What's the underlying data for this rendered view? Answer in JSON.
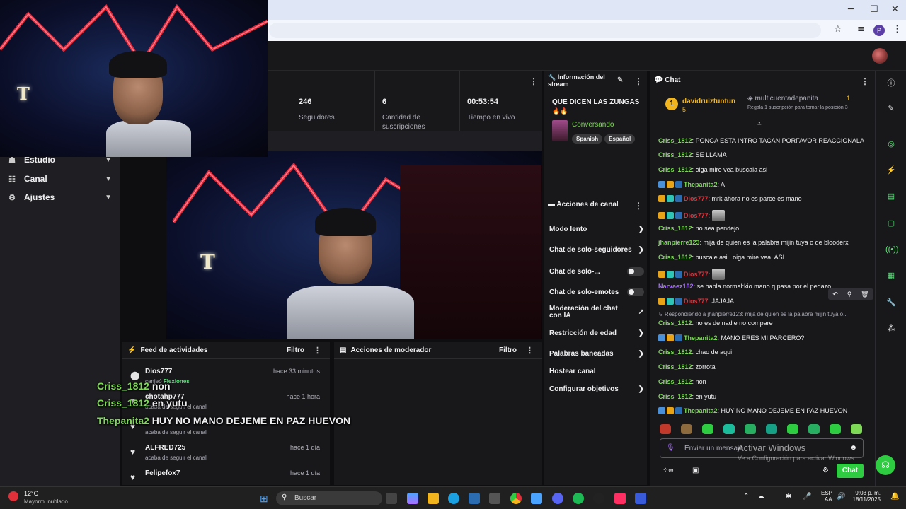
{
  "browser": {
    "minimize": "─",
    "maximize": "☐",
    "close": "✕",
    "star_icon": "star-icon",
    "profile_initial": "P"
  },
  "sidebar": {
    "items": [
      {
        "label": "Estudio",
        "icon": "☗"
      },
      {
        "label": "Canal",
        "icon": "☷"
      },
      {
        "label": "Ajustes",
        "icon": "⚙"
      }
    ]
  },
  "stats": [
    {
      "value": "246",
      "label": "Seguidores"
    },
    {
      "value": "6",
      "label": "Cantidad de suscripciones"
    },
    {
      "value": "00:53:54",
      "label": "Tiempo en vivo"
    }
  ],
  "stream_info": {
    "header": "Información del stream",
    "title": "QUE DICEN LAS ZUNGAS",
    "emoji": "🔥🔥",
    "category": "Conversando",
    "tags": [
      "Spanish",
      "Español"
    ]
  },
  "channel_actions": {
    "header": "Acciones de canal",
    "items": [
      {
        "label": "Modo lento",
        "kind": "chevron"
      },
      {
        "label": "Chat de solo-seguidores",
        "kind": "chevron"
      },
      {
        "label": "Chat de solo-...",
        "kind": "toggle"
      },
      {
        "label": "Chat de solo-emotes",
        "kind": "toggle"
      },
      {
        "label": "Moderación del chat con IA",
        "kind": "external"
      },
      {
        "label": "Restricción de edad",
        "kind": "chevron"
      },
      {
        "label": "Palabras baneadas",
        "kind": "chevron"
      },
      {
        "label": "Hostear canal",
        "kind": "none"
      },
      {
        "label": "Configurar objetivos",
        "kind": "chevron"
      }
    ]
  },
  "activity_feed": {
    "header": "Feed de actividades",
    "filter": "Filtro",
    "items": [
      {
        "name": "Dios777",
        "time": "hace 33 minutos",
        "action": "canjeó",
        "reward": "Flexiones"
      },
      {
        "name": "chotahp777",
        "time": "hace 1 hora",
        "action": "acaba de seguir el canal",
        "reward": ""
      },
      {
        "name": "",
        "time": "",
        "action": "acaba de seguir el canal",
        "reward": ""
      },
      {
        "name": "ALFRED725",
        "time": "hace 1 día",
        "action": "acaba de seguir el canal",
        "reward": ""
      },
      {
        "name": "Felipefox7",
        "time": "hace 1 día",
        "action": "",
        "reward": ""
      }
    ]
  },
  "mod_actions": {
    "header": "Acciones de moderador",
    "filter": "Filtro"
  },
  "overlay_chat": [
    {
      "user": "Criss_1812",
      "text": "non"
    },
    {
      "user": "Criss_1812",
      "text": "en yutu"
    },
    {
      "user": "Thepanita2",
      "text": "HUY NO MANO DEJEME EN PAZ HUEVON"
    }
  ],
  "chat": {
    "header": "Chat",
    "leaderboard": {
      "rank": "1",
      "user1": "davidruiztuntun",
      "user1_count": "5",
      "user2": "multicuentadepanita",
      "user2_count": "1",
      "promo": "Regala 1 suscripción para tomar la posición 3"
    },
    "messages": [
      {
        "user": "Criss_1812",
        "color": "#7ed957",
        "badges": [],
        "text": "PONGA ESTA INTRO TACAN PORFAVOR REACCIONALA"
      },
      {
        "user": "Criss_1812",
        "color": "#7ed957",
        "badges": [],
        "text": "SE LLAMA"
      },
      {
        "user": "Criss_1812",
        "color": "#7ed957",
        "badges": [],
        "text": "oiga mire vea buscala asi"
      },
      {
        "user": "Thepanita2",
        "color": "#7ed957",
        "badges": [
          "#4a90d9",
          "#e8a317",
          "#2b6cb0"
        ],
        "text": "A"
      },
      {
        "user": "Dios777",
        "color": "#e0313a",
        "badges": [
          "#e8a317",
          "#2ec4b6",
          "#2b6cb0"
        ],
        "text": "mrk ahora no es parce es mano"
      },
      {
        "user": "Dios777",
        "color": "#e0313a",
        "badges": [
          "#e8a317",
          "#2ec4b6",
          "#2b6cb0"
        ],
        "text": ""
      },
      {
        "user": "Criss_1812",
        "color": "#7ed957",
        "badges": [],
        "text": "no sea pendejo"
      },
      {
        "user": "jhanpierre123",
        "color": "#7ed957",
        "badges": [],
        "text": "mija de quien es la palabra mijin tuya o de blooderx"
      },
      {
        "user": "Criss_1812",
        "color": "#7ed957",
        "badges": [],
        "text": "buscale asi . oiga mire vea, ASI"
      },
      {
        "user": "Dios777",
        "color": "#e0313a",
        "badges": [
          "#e8a317",
          "#2ec4b6",
          "#2b6cb0"
        ],
        "text": ""
      },
      {
        "user": "Narvaez182",
        "color": "#a970ff",
        "badges": [],
        "text": "se habla normal:kio mano q pasa por el pedazo"
      },
      {
        "user": "Dios777",
        "color": "#e0313a",
        "badges": [
          "#e8a317",
          "#2ec4b6",
          "#2b6cb0"
        ],
        "text": "JAJAJA"
      },
      {
        "user": "",
        "color": "#adadb8",
        "badges": [],
        "text": "↳ Respondiendo a jhanpierre123: mija de quien es la palabra mijin tuya o..."
      },
      {
        "user": "Criss_1812",
        "color": "#7ed957",
        "badges": [],
        "text": "no es de nadie no compare"
      },
      {
        "user": "Thepanita2",
        "color": "#7ed957",
        "badges": [
          "#4a90d9",
          "#e8a317",
          "#2b6cb0"
        ],
        "text": "MANO ERES MI PARCERO?"
      },
      {
        "user": "Criss_1812",
        "color": "#7ed957",
        "badges": [],
        "text": "chao de aqui"
      },
      {
        "user": "Criss_1812",
        "color": "#7ed957",
        "badges": [],
        "text": "zorrota"
      },
      {
        "user": "Criss_1812",
        "color": "#7ed957",
        "badges": [],
        "text": "non"
      },
      {
        "user": "Criss_1812",
        "color": "#7ed957",
        "badges": [],
        "text": "en yutu"
      },
      {
        "user": "Thepanita2",
        "color": "#7ed957",
        "badges": [
          "#4a90d9",
          "#e8a317",
          "#2b6cb0"
        ],
        "text": "HUY NO MANO DEJEME EN PAZ HUEVON"
      }
    ],
    "input_placeholder": "Enviar un mensaje",
    "send_label": "Chat",
    "activate_title": "Activar Windows",
    "activate_sub": "Ve a Configuración para activar Windows."
  },
  "taskbar": {
    "weather_temp": "12°C",
    "weather_desc": "Mayorm. nublado",
    "search_placeholder": "Buscar",
    "lang_top": "ESP",
    "lang_bottom": "LAA",
    "time": "9:03 p. m.",
    "date": "18/11/2025"
  }
}
